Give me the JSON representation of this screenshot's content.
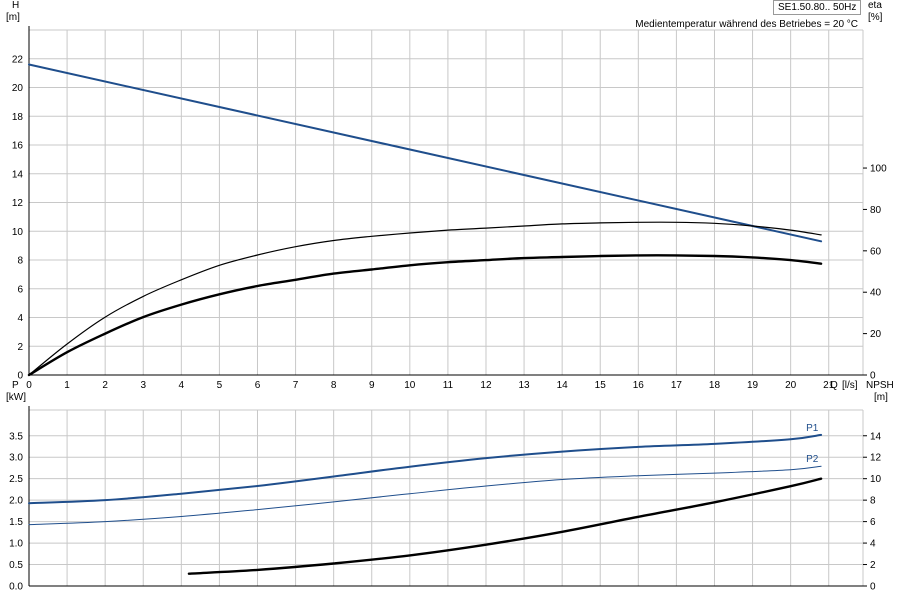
{
  "model": "SE1.50.80.. 50Hz",
  "note": "Medientemperatur während des Betriebes = 20 °C",
  "colors": {
    "grid": "#c8c8c8",
    "blue": "#1f4e8c",
    "black": "#000000"
  },
  "chart_data": [
    {
      "type": "line",
      "name": "H / eta",
      "xlabel": "Q [l/s]",
      "x_unit": "Q",
      "x_unit2": "[l/s]",
      "xlim": [
        0,
        21.9
      ],
      "xticks": [
        0,
        1,
        2,
        3,
        4,
        5,
        6,
        7,
        8,
        9,
        10,
        11,
        12,
        13,
        14,
        15,
        16,
        17,
        18,
        19,
        20,
        21
      ],
      "ylabel": "H",
      "ylabel_unit": "[m]",
      "ylim": [
        0,
        24
      ],
      "yticks": [
        0,
        2,
        4,
        6,
        8,
        10,
        12,
        14,
        16,
        18,
        20,
        22
      ],
      "y2label": "eta",
      "y2label_unit": "[%]",
      "y2lim": [
        0,
        166.7
      ],
      "y2ticks": [
        0,
        20,
        40,
        60,
        80,
        100
      ],
      "grid": true,
      "series": [
        {
          "key": "H",
          "axis": "left",
          "color": "#1f4e8c",
          "width": 2,
          "x": [
            0,
            20.8
          ],
          "y": [
            21.6,
            9.3
          ]
        },
        {
          "key": "eta_pump",
          "axis": "right",
          "color": "#000000",
          "width": 1.2,
          "x": [
            0,
            1,
            2,
            3,
            4,
            5,
            6,
            7,
            8,
            9,
            10,
            11,
            12,
            13,
            14,
            15,
            16,
            17,
            18,
            19,
            20,
            20.8
          ],
          "y": [
            0,
            15,
            28,
            38,
            46,
            53,
            58,
            62,
            65,
            67,
            68.6,
            70,
            71,
            72,
            73,
            73.5,
            73.8,
            73.8,
            73.3,
            72,
            70,
            67.7
          ]
        },
        {
          "key": "eta_total",
          "axis": "right",
          "color": "#000000",
          "width": 2.4,
          "x": [
            0,
            1,
            2,
            3,
            4,
            5,
            6,
            7,
            8,
            9,
            10,
            11,
            12,
            13,
            14,
            15,
            16,
            17,
            18,
            19,
            20,
            20.8
          ],
          "y": [
            0,
            11,
            20,
            28,
            34,
            39,
            43,
            46,
            49,
            51,
            53,
            54.5,
            55.5,
            56.5,
            57,
            57.5,
            57.8,
            57.8,
            57.5,
            56.8,
            55.5,
            53.8
          ]
        }
      ]
    },
    {
      "type": "line",
      "name": "P / NPSH",
      "xlim": [
        0,
        21.9
      ],
      "xticks": [
        0,
        1,
        2,
        3,
        4,
        5,
        6,
        7,
        8,
        9,
        10,
        11,
        12,
        13,
        14,
        15,
        16,
        17,
        18,
        19,
        20,
        21
      ],
      "ylabel": "P",
      "ylabel_unit": "[kW]",
      "ylim": [
        0,
        4.1
      ],
      "yticks": [
        "0.0",
        "0.5",
        "1.0",
        "1.5",
        "2.0",
        "2.5",
        "3.0",
        "3.5"
      ],
      "y2label": "NPSH",
      "y2label_unit": "[m]",
      "y2lim": [
        0,
        16.4
      ],
      "y2ticks": [
        0,
        2,
        4,
        6,
        8,
        10,
        12,
        14
      ],
      "grid": true,
      "series": [
        {
          "name": "P1",
          "axis": "left",
          "color": "#1f4e8c",
          "width": 2,
          "x": [
            0,
            2,
            4,
            6,
            8,
            10,
            12,
            14,
            16,
            18,
            20,
            20.8
          ],
          "y": [
            1.93,
            2.0,
            2.15,
            2.33,
            2.55,
            2.78,
            2.98,
            3.13,
            3.24,
            3.31,
            3.42,
            3.52
          ]
        },
        {
          "name": "P2",
          "axis": "left",
          "color": "#1f4e8c",
          "width": 1,
          "x": [
            0,
            2,
            4,
            6,
            8,
            10,
            12,
            14,
            16,
            18,
            20,
            20.8
          ],
          "y": [
            1.43,
            1.5,
            1.62,
            1.78,
            1.96,
            2.15,
            2.33,
            2.48,
            2.57,
            2.63,
            2.71,
            2.79
          ]
        },
        {
          "key": "NPSH",
          "axis": "right",
          "color": "#000000",
          "width": 2.4,
          "x": [
            4.2,
            6,
            8,
            10,
            12,
            14,
            16,
            18,
            20,
            20.8
          ],
          "y": [
            1.15,
            1.5,
            2.1,
            2.85,
            3.85,
            5.05,
            6.45,
            7.8,
            9.3,
            10.0
          ]
        }
      ]
    }
  ]
}
